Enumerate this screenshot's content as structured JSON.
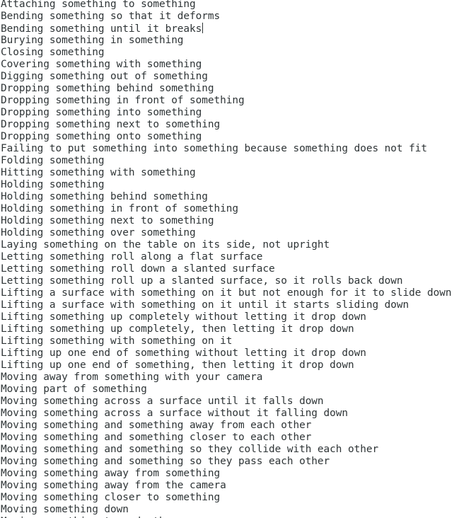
{
  "editor": {
    "caret_line_index": 2,
    "lines": [
      "Attaching something to something",
      "Bending something so that it deforms",
      "Bending something until it breaks",
      "Burying something in something",
      "Closing something",
      "Covering something with something",
      "Digging something out of something",
      "Dropping something behind something",
      "Dropping something in front of something",
      "Dropping something into something",
      "Dropping something next to something",
      "Dropping something onto something",
      "Failing to put something into something because something does not fit",
      "Folding something",
      "Hitting something with something",
      "Holding something",
      "Holding something behind something",
      "Holding something in front of something",
      "Holding something next to something",
      "Holding something over something",
      "Laying something on the table on its side, not upright",
      "Letting something roll along a flat surface",
      "Letting something roll down a slanted surface",
      "Letting something roll up a slanted surface, so it rolls back down",
      "Lifting a surface with something on it but not enough for it to slide down",
      "Lifting a surface with something on it until it starts sliding down",
      "Lifting something up completely without letting it drop down",
      "Lifting something up completely, then letting it drop down",
      "Lifting something with something on it",
      "Lifting up one end of something without letting it drop down",
      "Lifting up one end of something, then letting it drop down",
      "Moving away from something with your camera",
      "Moving part of something",
      "Moving something across a surface until it falls down",
      "Moving something across a surface without it falling down",
      "Moving something and something away from each other",
      "Moving something and something closer to each other",
      "Moving something and something so they collide with each other",
      "Moving something and something so they pass each other",
      "Moving something away from something",
      "Moving something away from the camera",
      "Moving something closer to something",
      "Moving something down",
      "Moving something towards the camera"
    ]
  }
}
